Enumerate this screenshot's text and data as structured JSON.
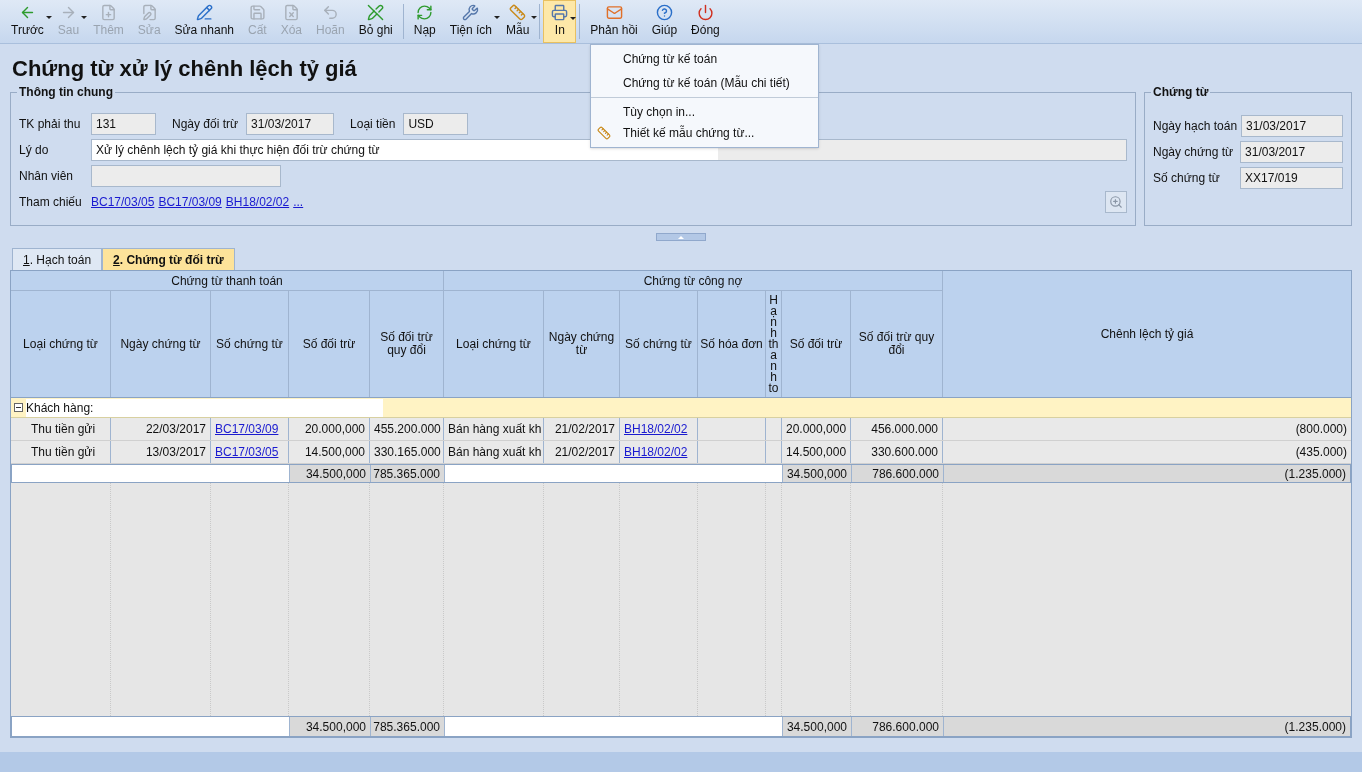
{
  "toolbar": [
    {
      "label": "Trước",
      "disabled": false,
      "dropdown": true,
      "selected": false
    },
    {
      "label": "Sau",
      "disabled": true,
      "dropdown": true,
      "selected": false
    },
    {
      "label": "Thêm",
      "disabled": true,
      "dropdown": false,
      "selected": false
    },
    {
      "label": "Sửa",
      "disabled": true,
      "dropdown": false,
      "selected": false
    },
    {
      "label": "Sửa nhanh",
      "disabled": false,
      "dropdown": false,
      "selected": false
    },
    {
      "label": "Cất",
      "disabled": true,
      "dropdown": false,
      "selected": false
    },
    {
      "label": "Xóa",
      "disabled": true,
      "dropdown": false,
      "selected": false
    },
    {
      "label": "Hoãn",
      "disabled": true,
      "dropdown": false,
      "selected": false
    },
    {
      "label": "Bỏ ghi",
      "disabled": false,
      "dropdown": false,
      "selected": false
    },
    {
      "label": "Nạp",
      "disabled": false,
      "dropdown": false,
      "selected": false
    },
    {
      "label": "Tiện ích",
      "disabled": false,
      "dropdown": true,
      "selected": false
    },
    {
      "label": "Mẫu",
      "disabled": false,
      "dropdown": true,
      "selected": false
    },
    {
      "label": "In",
      "disabled": false,
      "dropdown": true,
      "selected": true
    },
    {
      "label": "Phản hồi",
      "disabled": false,
      "dropdown": false,
      "selected": false
    },
    {
      "label": "Giúp",
      "disabled": false,
      "dropdown": false,
      "selected": false
    },
    {
      "label": "Đóng",
      "disabled": false,
      "dropdown": false,
      "selected": false
    }
  ],
  "print_menu": [
    {
      "label": "Chứng từ kế toán",
      "separator_before": false
    },
    {
      "label": "Chứng từ kế toán (Mẫu chi tiết)",
      "separator_before": false
    },
    {
      "label": "Tùy chọn in...",
      "separator_before": true
    },
    {
      "label": "Thiết kế mẫu chứng từ...",
      "separator_before": false
    }
  ],
  "title": "Chứng từ xử lý chênh lệch tỷ giá",
  "general": {
    "legend": "Thông tin chung",
    "account_label": "TK phải thu",
    "account": "131",
    "date_label": "Ngày đối trừ",
    "date": "31/03/2017",
    "currency_label": "Loại tiền",
    "currency": "USD",
    "reason_label": "Lý do",
    "reason": "Xử lý chênh lệch tỷ giá khi thực hiện đối trừ chứng từ",
    "employee_label": "Nhân viên",
    "reference_label": "Tham chiếu",
    "references": [
      "BC17/03/05",
      "BC17/03/09",
      "BH18/02/02",
      "..."
    ]
  },
  "voucher": {
    "legend": "Chứng từ",
    "fields": [
      {
        "label": "Ngày hạch toán",
        "value": "31/03/2017"
      },
      {
        "label": "Ngày chứng từ",
        "value": "31/03/2017"
      },
      {
        "label": "Số chứng từ",
        "value": "XX17/019"
      }
    ]
  },
  "tabs": [
    {
      "key": "1",
      "label": ". Hạch toán",
      "selected": false
    },
    {
      "key": "2",
      "label": ". Chứng từ đối trừ",
      "selected": true
    }
  ],
  "table": {
    "groups": [
      {
        "label": "Chứng từ thanh toán",
        "columns": [
          "Loại chứng từ",
          "Ngày chứng từ",
          "Số chứng từ",
          "Số đối trừ",
          "Số đối trừ quy đổi"
        ]
      },
      {
        "label": "Chứng từ công nợ",
        "columns": [
          "Loại chứng từ",
          "Ngày chứng từ",
          "Số chứng từ",
          "Số hóa đơn",
          "Hạnh thanh to",
          "Số đối trừ",
          "Số đối trừ quy đổi"
        ]
      }
    ],
    "last_column": "Chênh lệch tỷ giá",
    "group_row": {
      "label": "Khách hàng:",
      "expanded": true
    },
    "rows": [
      {
        "payment": [
          "Thu tiền gửi",
          "22/03/2017",
          "BC17/03/09",
          "20.000,000",
          "455.200.000"
        ],
        "debt": [
          "Bán hàng xuất kh",
          "21/02/2017",
          "BH18/02/02"
        ],
        "debt_amounts": [
          "20.000,000",
          "456.000.000"
        ],
        "difference": "(800.000)"
      },
      {
        "payment": [
          "Thu tiền gửi",
          "13/03/2017",
          "BC17/03/05",
          "14.500,000",
          "330.165.000"
        ],
        "debt": [
          "Bán hàng xuất kh",
          "21/02/2017",
          "BH18/02/02"
        ],
        "debt_amounts": [
          "14.500,000",
          "330.600.000"
        ],
        "difference": "(435.000)"
      }
    ],
    "subtotal": {
      "payment": [
        "34.500,000",
        "785.365.000"
      ],
      "debt": [
        "34.500,000",
        "786.600.000"
      ],
      "difference": "(1.235.000)"
    },
    "total": {
      "payment": [
        "34.500,000",
        "785.365.000"
      ],
      "debt": [
        "34.500,000",
        "786.600.000"
      ],
      "difference": "(1.235.000)"
    }
  }
}
